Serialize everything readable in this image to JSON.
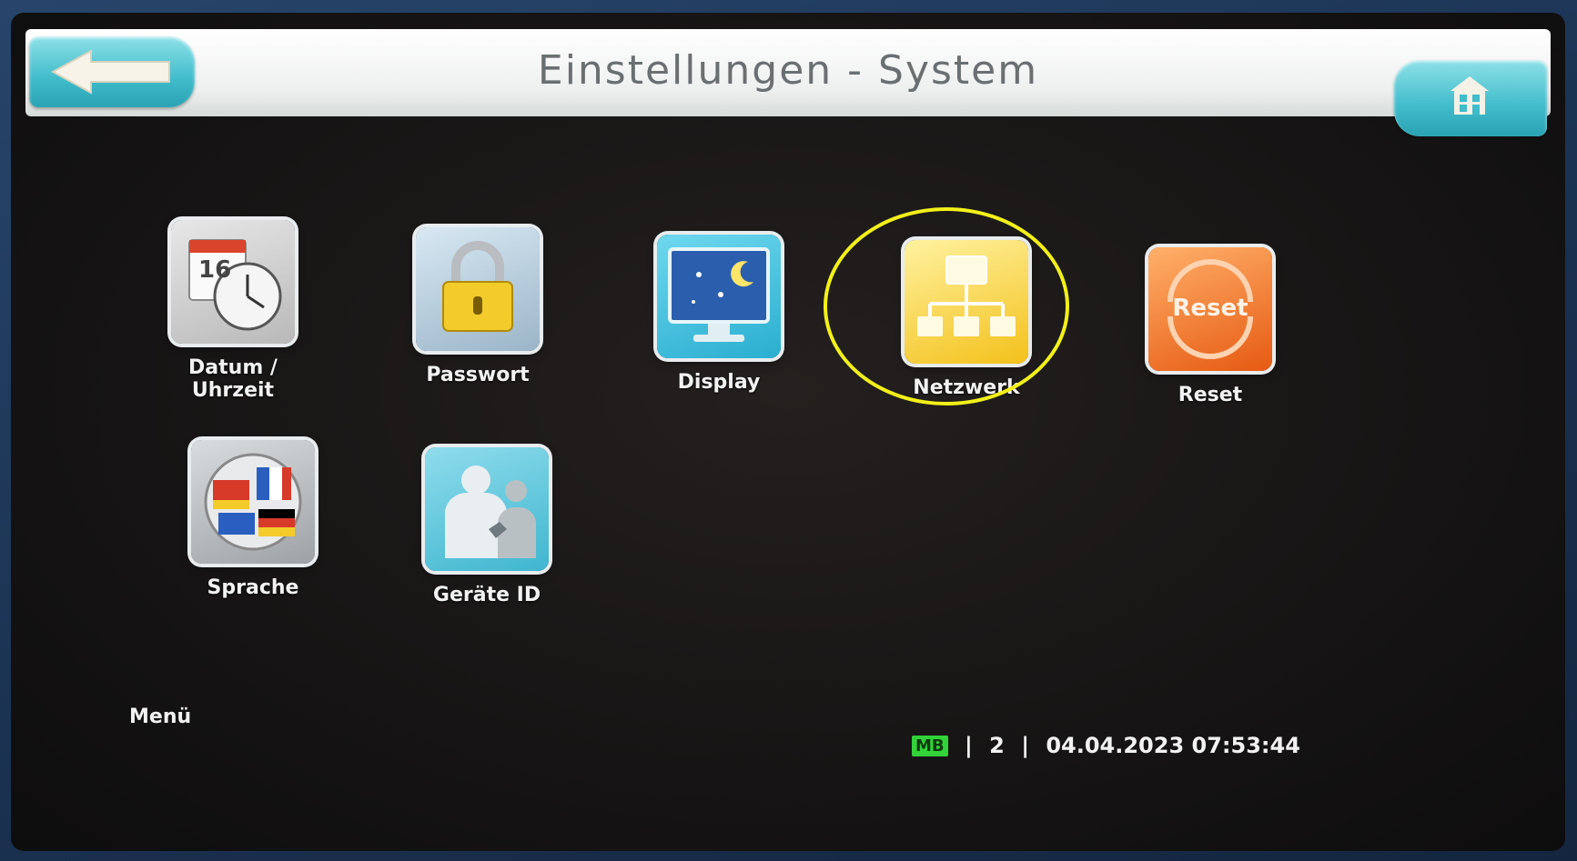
{
  "header": {
    "title": "Einstellungen - System",
    "back_icon": "back-arrow-icon",
    "home_icon": "home-icon"
  },
  "tiles": [
    {
      "label": "Datum / Uhrzeit",
      "icon": "calendar-clock-icon",
      "icon_text": "16"
    },
    {
      "label": "Passwort",
      "icon": "padlock-icon"
    },
    {
      "label": "Display",
      "icon": "monitor-icon"
    },
    {
      "label": "Netzwerk",
      "icon": "network-icon"
    },
    {
      "label": "Reset",
      "icon": "reset-icon",
      "icon_text": "Reset"
    },
    {
      "label": "Sprache",
      "icon": "language-flags-icon"
    },
    {
      "label": "Geräte ID",
      "icon": "device-id-icon"
    }
  ],
  "footer": {
    "menu_label": "Menü",
    "status": {
      "badge": "MB",
      "separator": "|",
      "number": "2",
      "datetime": "04.04.2023 07:53:44"
    }
  },
  "colors": {
    "accent": "#41bccb",
    "highlight": "#f3f01a",
    "badge": "#32d23a"
  }
}
